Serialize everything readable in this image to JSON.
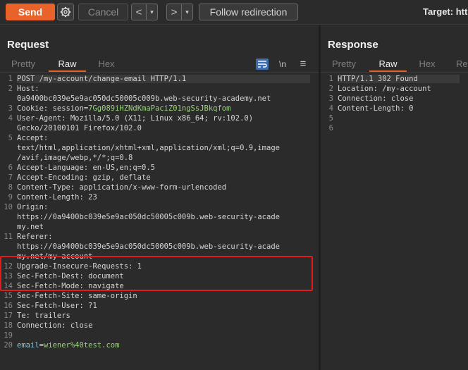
{
  "toolbar": {
    "send_label": "Send",
    "cancel_label": "Cancel",
    "back_label": "<",
    "forward_label": ">",
    "dropdown_glyph": "▾",
    "follow_label": "Follow redirection",
    "target_label": "Target: htt",
    "accent_color": "#e8622a"
  },
  "request": {
    "title": "Request",
    "tabs": [
      "Pretty",
      "Raw",
      "Hex"
    ],
    "active_tab": "Raw",
    "tools": {
      "newline_label": "\\n",
      "menu_glyph": "≡"
    },
    "lines": [
      {
        "n": "1",
        "text": "POST /my-account/change-email HTTP/1.1"
      },
      {
        "n": "2",
        "text": "Host:"
      },
      {
        "n": "",
        "text": "0a9400bc039e5e9ac050dc50005c009b.web-security-academy.net"
      },
      {
        "n": "3",
        "cookie_label": "Cookie: ",
        "cookie_name": "session=",
        "cookie_value": "7Gg089iHZNdKmaPaciZ01ngSsJBkqfom"
      },
      {
        "n": "4",
        "text": "User-Agent: Mozilla/5.0 (X11; Linux x86_64; rv:102.0)"
      },
      {
        "n": "",
        "text": "Gecko/20100101 Firefox/102.0"
      },
      {
        "n": "5",
        "text": "Accept:"
      },
      {
        "n": "",
        "text": "text/html,application/xhtml+xml,application/xml;q=0.9,image"
      },
      {
        "n": "",
        "text": "/avif,image/webp,*/*;q=0.8"
      },
      {
        "n": "6",
        "text": "Accept-Language: en-US,en;q=0.5"
      },
      {
        "n": "7",
        "text": "Accept-Encoding: gzip, deflate"
      },
      {
        "n": "8",
        "text": "Content-Type: application/x-www-form-urlencoded"
      },
      {
        "n": "9",
        "text": "Content-Length: 23"
      },
      {
        "n": "10",
        "text": "Origin:"
      },
      {
        "n": "",
        "text": "https://0a9400bc039e5e9ac050dc50005c009b.web-security-acade"
      },
      {
        "n": "",
        "text": "my.net"
      },
      {
        "n": "11",
        "text": "Referer:"
      },
      {
        "n": "",
        "text": "https://0a9400bc039e5e9ac050dc50005c009b.web-security-acade"
      },
      {
        "n": "",
        "text": "my.net/my-account"
      },
      {
        "n": "12",
        "text": "Upgrade-Insecure-Requests: 1"
      },
      {
        "n": "13",
        "text": "Sec-Fetch-Dest: document"
      },
      {
        "n": "14",
        "text": "Sec-Fetch-Mode: navigate"
      },
      {
        "n": "15",
        "text": "Sec-Fetch-Site: same-origin"
      },
      {
        "n": "16",
        "text": "Sec-Fetch-User: ?1"
      },
      {
        "n": "17",
        "text": "Te: trailers"
      },
      {
        "n": "18",
        "text": "Connection: close"
      },
      {
        "n": "19",
        "text": ""
      },
      {
        "n": "20",
        "body_key": "email",
        "body_eq": "=",
        "body_value": "wiener%40test.com"
      }
    ]
  },
  "response": {
    "title": "Response",
    "tabs": [
      "Pretty",
      "Raw",
      "Hex",
      "Re"
    ],
    "active_tab": "Raw",
    "lines": [
      {
        "n": "1",
        "text": "HTTP/1.1 302 Found"
      },
      {
        "n": "2",
        "text": "Location: /my-account"
      },
      {
        "n": "3",
        "text": "Connection: close"
      },
      {
        "n": "4",
        "text": "Content-Length: 0"
      },
      {
        "n": "5",
        "text": ""
      },
      {
        "n": "6",
        "text": ""
      }
    ]
  },
  "highlight": {
    "color": "#e01c1c",
    "target": "Referer header"
  }
}
